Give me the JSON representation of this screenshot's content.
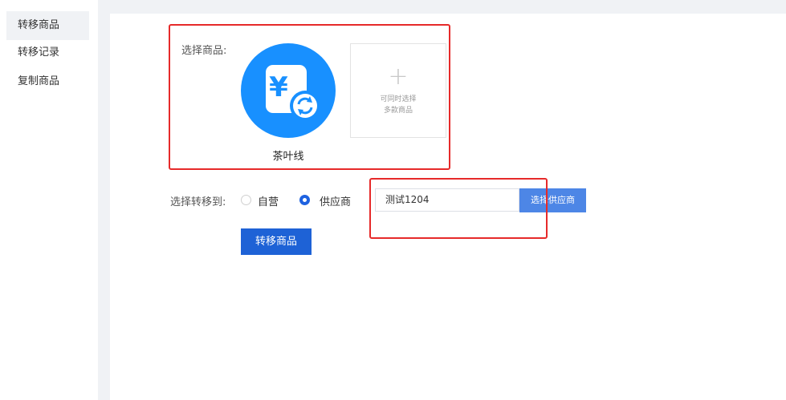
{
  "sidebar": {
    "items": [
      {
        "label": "转移商品"
      },
      {
        "label": "转移记录"
      },
      {
        "label": "复制商品"
      }
    ]
  },
  "product_select": {
    "label": "选择商品:",
    "product": {
      "name": "茶叶线",
      "icon": "yen-refresh-icon"
    },
    "add": {
      "hint_line1": "可同时选择",
      "hint_line2": "多款商品"
    }
  },
  "transfer_to": {
    "label": "选择转移到:",
    "options": [
      {
        "label": "自营",
        "selected": false
      },
      {
        "label": "供应商",
        "selected": true
      }
    ]
  },
  "supplier": {
    "value": "测试1204",
    "button_label": "选择供应商"
  },
  "submit": {
    "label": "转移商品"
  },
  "colors": {
    "primary": "#1e62d6",
    "icon_blue": "#1890ff",
    "highlight_red": "#e62a2a"
  }
}
